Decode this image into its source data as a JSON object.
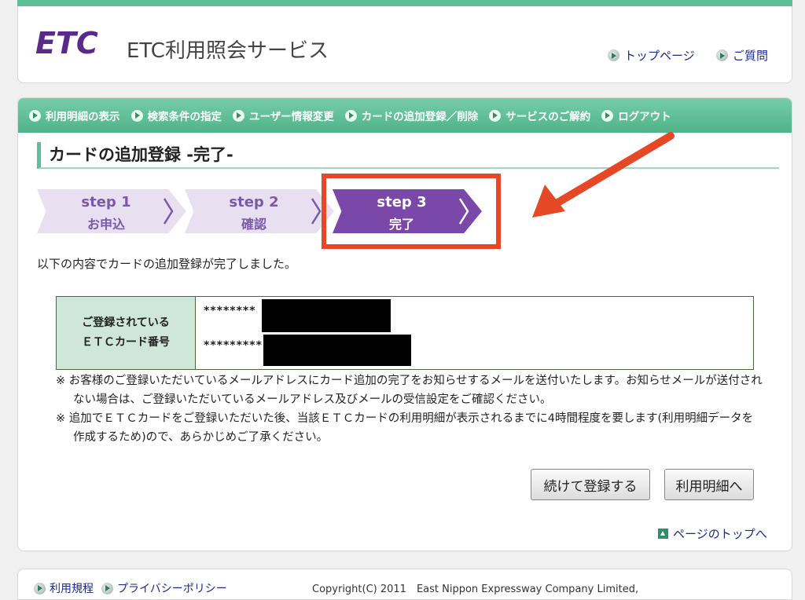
{
  "header": {
    "logo_text": "ETC",
    "service_name": "ETC利用照会サービス",
    "links": [
      "トップページ",
      "ご質問"
    ]
  },
  "nav": {
    "items": [
      "利用明細の表示",
      "検索条件の指定",
      "ユーザー情報変更",
      "カードの追加登録／削除",
      "サービスのご解約",
      "ログアウト"
    ]
  },
  "page_title": "カードの追加登録 -完了-",
  "steps": [
    {
      "num": "step 1",
      "label": "お申込"
    },
    {
      "num": "step 2",
      "label": "確認"
    },
    {
      "num": "step 3",
      "label": "完了"
    }
  ],
  "message": "以下の内容でカードの追加登録が完了しました。",
  "card_table": {
    "header_line1": "ご登録されている",
    "header_line2": "ＥＴＣカード番号",
    "cards": [
      "********",
      "*********"
    ]
  },
  "notes": [
    "※ お客様のご登録いただいているメールアドレスにカード追加の完了をお知らせするメールを送付いたします。お知らせメールが送付されない場合は、ご登録いただいているメールアドレス及びメールの受信設定をご確認ください。",
    "※ 追加でＥＴＣカードをご登録いただいた後、当該ＥＴＣカードの利用明細が表示されるまでに4時間程度を要します(利用明細データを作成するため)ので、あらかじめご了承ください。"
  ],
  "buttons": {
    "continue": "続けて登録する",
    "statement": "利用明細へ"
  },
  "page_top_link": "ページのトップへ",
  "footer": {
    "terms": "利用規程",
    "privacy": "プライバシーポリシー",
    "copyright": "Copyright(C) 2011　East Nippon Expressway Company Limited,"
  },
  "colors": {
    "accent_green": "#5dbf98",
    "step_active": "#7a48a8",
    "highlight_red": "#e64826"
  }
}
